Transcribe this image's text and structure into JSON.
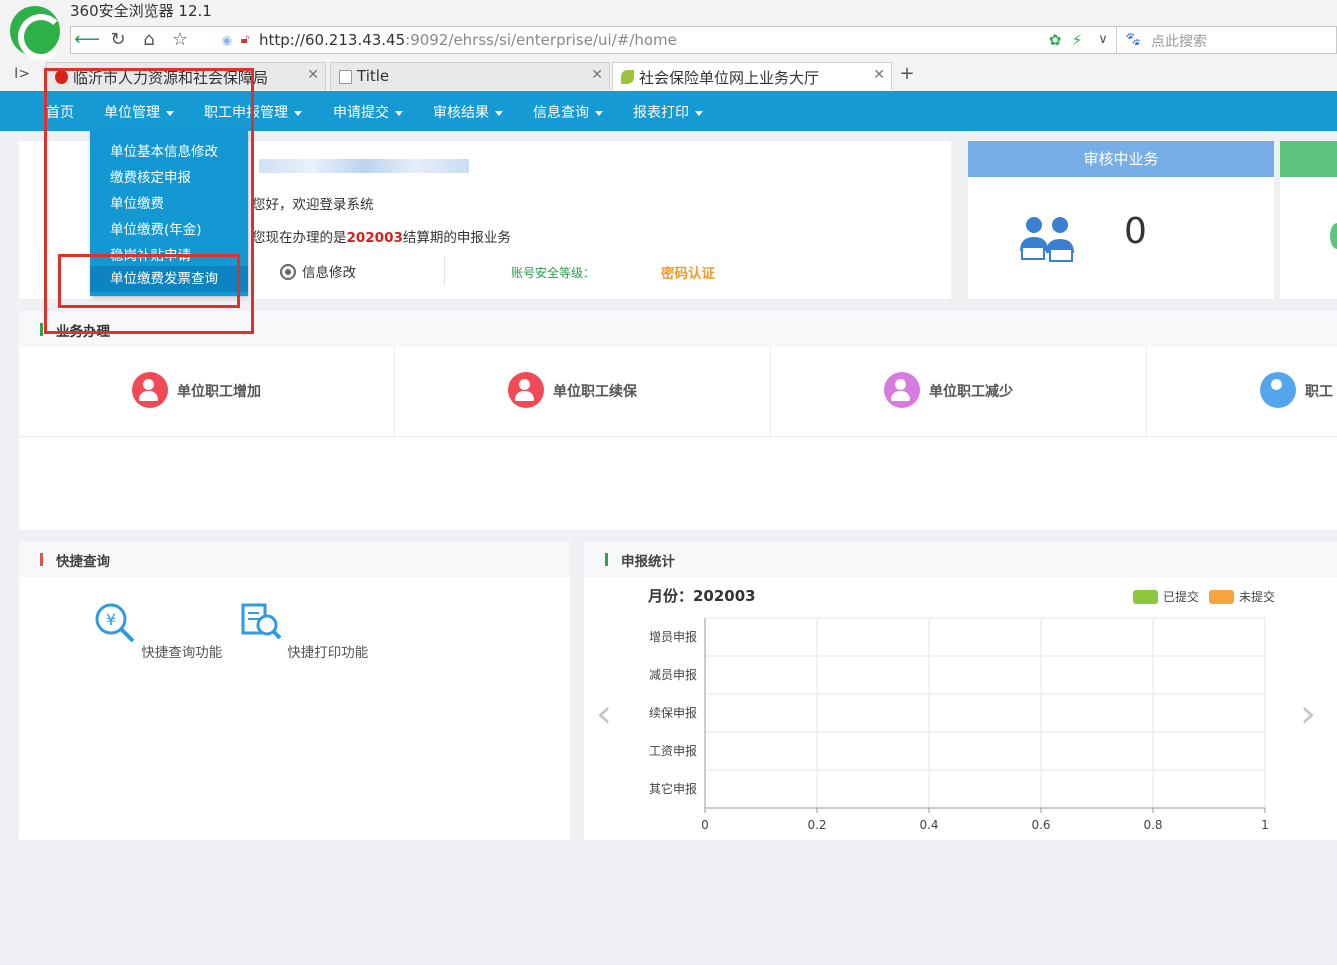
{
  "browser": {
    "title": "360安全浏览器 12.1",
    "url_host": "http://60.213.43.45",
    "url_path": ":9092/ehrss/si/enterprise/ui/#/home",
    "search_placeholder": "点此搜索",
    "tabs": [
      {
        "label": "临沂市人力资源和社会保障局"
      },
      {
        "label": "Title"
      },
      {
        "label": "社会保险单位网上业务大厅"
      }
    ]
  },
  "nav": {
    "items": [
      {
        "label": "首页"
      },
      {
        "label": "单位管理"
      },
      {
        "label": "职工申报管理"
      },
      {
        "label": "申请提交"
      },
      {
        "label": "审核结果"
      },
      {
        "label": "信息查询"
      },
      {
        "label": "报表打印"
      }
    ]
  },
  "dropdown": {
    "items": [
      {
        "label": "单位基本信息修改"
      },
      {
        "label": "缴费核定申报"
      },
      {
        "label": "单位缴费"
      },
      {
        "label": "单位缴费(年金)"
      },
      {
        "label": "稳岗补贴申请"
      },
      {
        "label": "单位缴费发票查询"
      }
    ]
  },
  "welcome": {
    "greeting": "您好，欢迎登录系统",
    "period_prefix": "您现在办理的是",
    "period": "202003",
    "period_suffix": "结算期的申报业务",
    "info_edit": "信息修改",
    "security_label": "账号安全等级：",
    "security_value": "密码认证"
  },
  "audit": {
    "title": "审核中业务",
    "count": "0"
  },
  "business": {
    "title": "业务办理",
    "items": [
      {
        "label": "单位职工增加",
        "color": "#ef4a55"
      },
      {
        "label": "单位职工续保",
        "color": "#ef4a55"
      },
      {
        "label": "单位职工减少",
        "color": "#d67be0"
      },
      {
        "label": "职工",
        "color": "#53a6ec"
      }
    ]
  },
  "quick": {
    "title": "快捷查询",
    "items": [
      {
        "label": "快捷查询功能"
      },
      {
        "label": "快捷打印功能"
      }
    ]
  },
  "stats": {
    "title": "申报统计",
    "month_label": "月份：202003",
    "legend": [
      {
        "label": "已提交",
        "color": "#8dc63f"
      },
      {
        "label": "未提交",
        "color": "#f7a541"
      }
    ]
  },
  "chart_data": {
    "type": "bar",
    "orientation": "horizontal",
    "categories": [
      "增员申报",
      "减员申报",
      "续保申报",
      "工资申报",
      "其它申报"
    ],
    "series": [
      {
        "name": "已提交",
        "values": [
          0,
          0,
          0,
          0,
          0
        ],
        "color": "#8dc63f"
      },
      {
        "name": "未提交",
        "values": [
          0,
          0,
          0,
          0,
          0
        ],
        "color": "#f7a541"
      }
    ],
    "xlim": [
      0,
      1
    ],
    "xticks": [
      "0",
      "0.2",
      "0.4",
      "0.6",
      "0.8",
      "1"
    ],
    "grid": true,
    "legend_position": "top-right"
  }
}
